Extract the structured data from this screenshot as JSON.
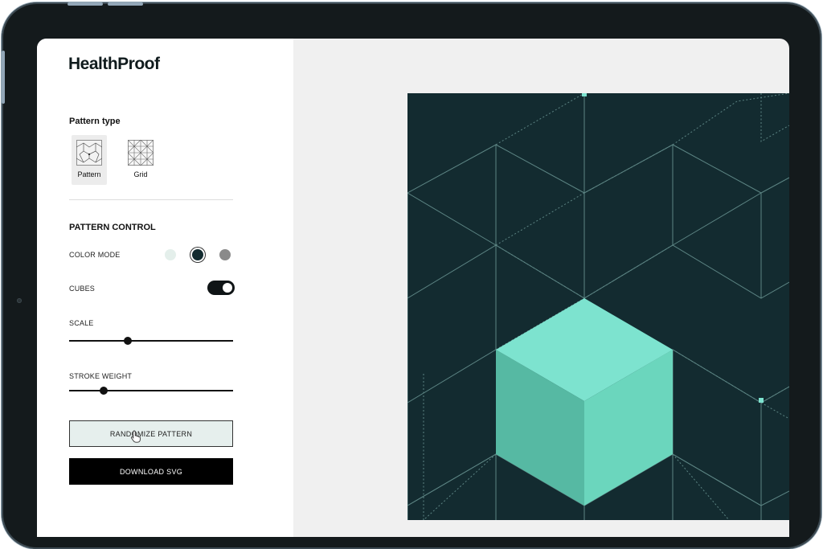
{
  "brand": {
    "logo_text": "HealthProof"
  },
  "pattern_type": {
    "title": "Pattern type",
    "options": [
      {
        "label": "Pattern",
        "selected": true
      },
      {
        "label": "Grid",
        "selected": false
      }
    ]
  },
  "pattern_control": {
    "title": "PATTERN CONTROL",
    "color_mode": {
      "label": "COLOR MODE",
      "swatches": [
        {
          "name": "light",
          "color": "#e4efeb",
          "selected": false
        },
        {
          "name": "dark",
          "color": "#132b30",
          "selected": true
        },
        {
          "name": "gray",
          "color": "#8a8a8a",
          "selected": false
        }
      ]
    },
    "cubes": {
      "label": "CUBES",
      "enabled": true
    },
    "scale": {
      "label": "SCALE",
      "value": 0.36
    },
    "stroke_weight": {
      "label": "STROKE WEIGHT",
      "value": 0.21
    }
  },
  "actions": {
    "randomize_label": "RANDOMIZE PATTERN",
    "download_label": "DOWNLOAD SVG"
  },
  "preview": {
    "background_color": "#132b30",
    "line_color": "#5c8483",
    "cube_colors": {
      "top": "#7de3cf",
      "left": "#56b9a3",
      "right": "#6bd6bd"
    }
  }
}
